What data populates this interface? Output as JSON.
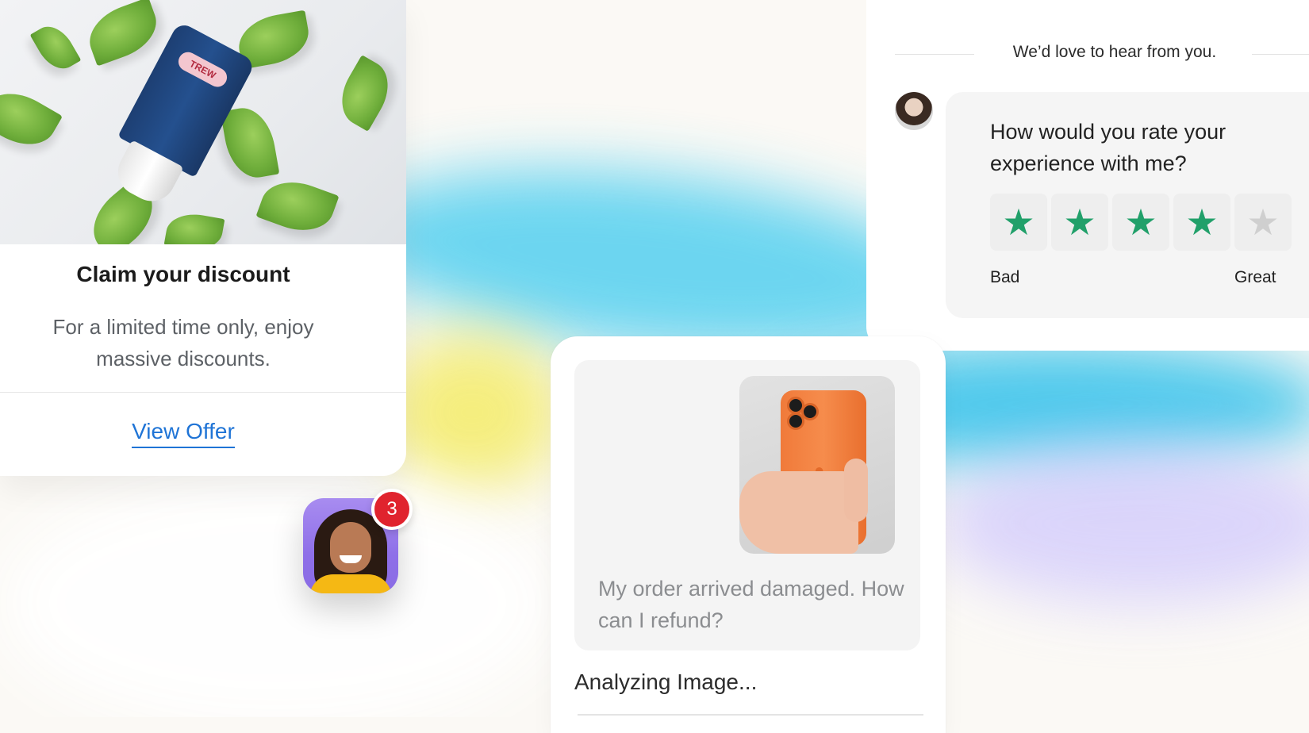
{
  "discount_card": {
    "title": "Claim your discount",
    "description": "For a limited time only, enjoy massive discounts.",
    "cta_label": "View Offer",
    "product_label": "TREW"
  },
  "avatar": {
    "notification_count": "3"
  },
  "rating_card": {
    "heading": "We’d love to hear from you.",
    "question": "How would you rate your experience with me?",
    "stars": [
      {
        "symbol": "★",
        "filled": true
      },
      {
        "symbol": "★",
        "filled": true
      },
      {
        "symbol": "★",
        "filled": true
      },
      {
        "symbol": "★",
        "filled": true
      },
      {
        "symbol": "★",
        "filled": false
      }
    ],
    "rating_value": 4,
    "rating_max": 5,
    "low_label": "Bad",
    "high_label": "Great",
    "star_color": "#21a06a"
  },
  "chat_card": {
    "message": "My order arrived damaged. How can I refund?",
    "status": "Analyzing Image..."
  },
  "colors": {
    "link": "#1f74d6",
    "badge": "#e0232e",
    "star_on": "#21a06a",
    "star_off": "#cfcfcf"
  }
}
